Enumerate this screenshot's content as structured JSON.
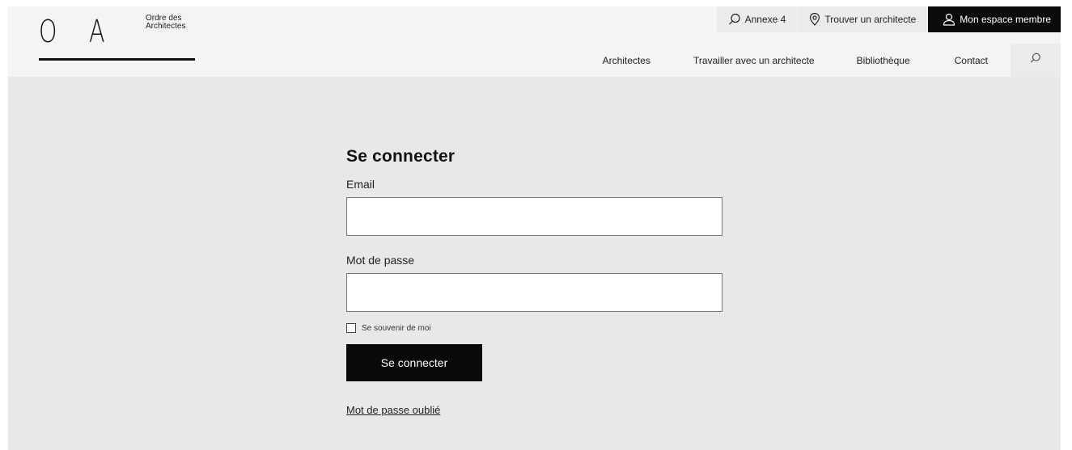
{
  "logo": {
    "letter_1": "O",
    "letter_2": "A",
    "name_line_1": "Ordre des",
    "name_line_2": "Architectes"
  },
  "topbar": {
    "annexe_label": "Annexe 4",
    "find_architect_label": "Trouver un architecte",
    "member_label": "Mon espace membre"
  },
  "nav": {
    "items": [
      {
        "label": "Architectes"
      },
      {
        "label": "Travailler avec un architecte"
      },
      {
        "label": "Bibliothèque"
      },
      {
        "label": "Contact"
      }
    ]
  },
  "login": {
    "title": "Se connecter",
    "email_label": "Email",
    "email_value": "",
    "password_label": "Mot de passe",
    "password_value": "",
    "remember_label": "Se souvenir de moi",
    "remember_checked": false,
    "submit_label": "Se connecter",
    "forgot_label": "Mot de passe oublié"
  },
  "icons": {
    "annexe": "search-icon",
    "find_architect": "map-pin-icon",
    "member": "user-icon",
    "nav_search": "search-icon"
  },
  "colors": {
    "page_background": "#e8e8e8",
    "header_background": "#f4f4f4",
    "primary_button": "#0a0a0a",
    "member_button": "#0b0b0b"
  }
}
